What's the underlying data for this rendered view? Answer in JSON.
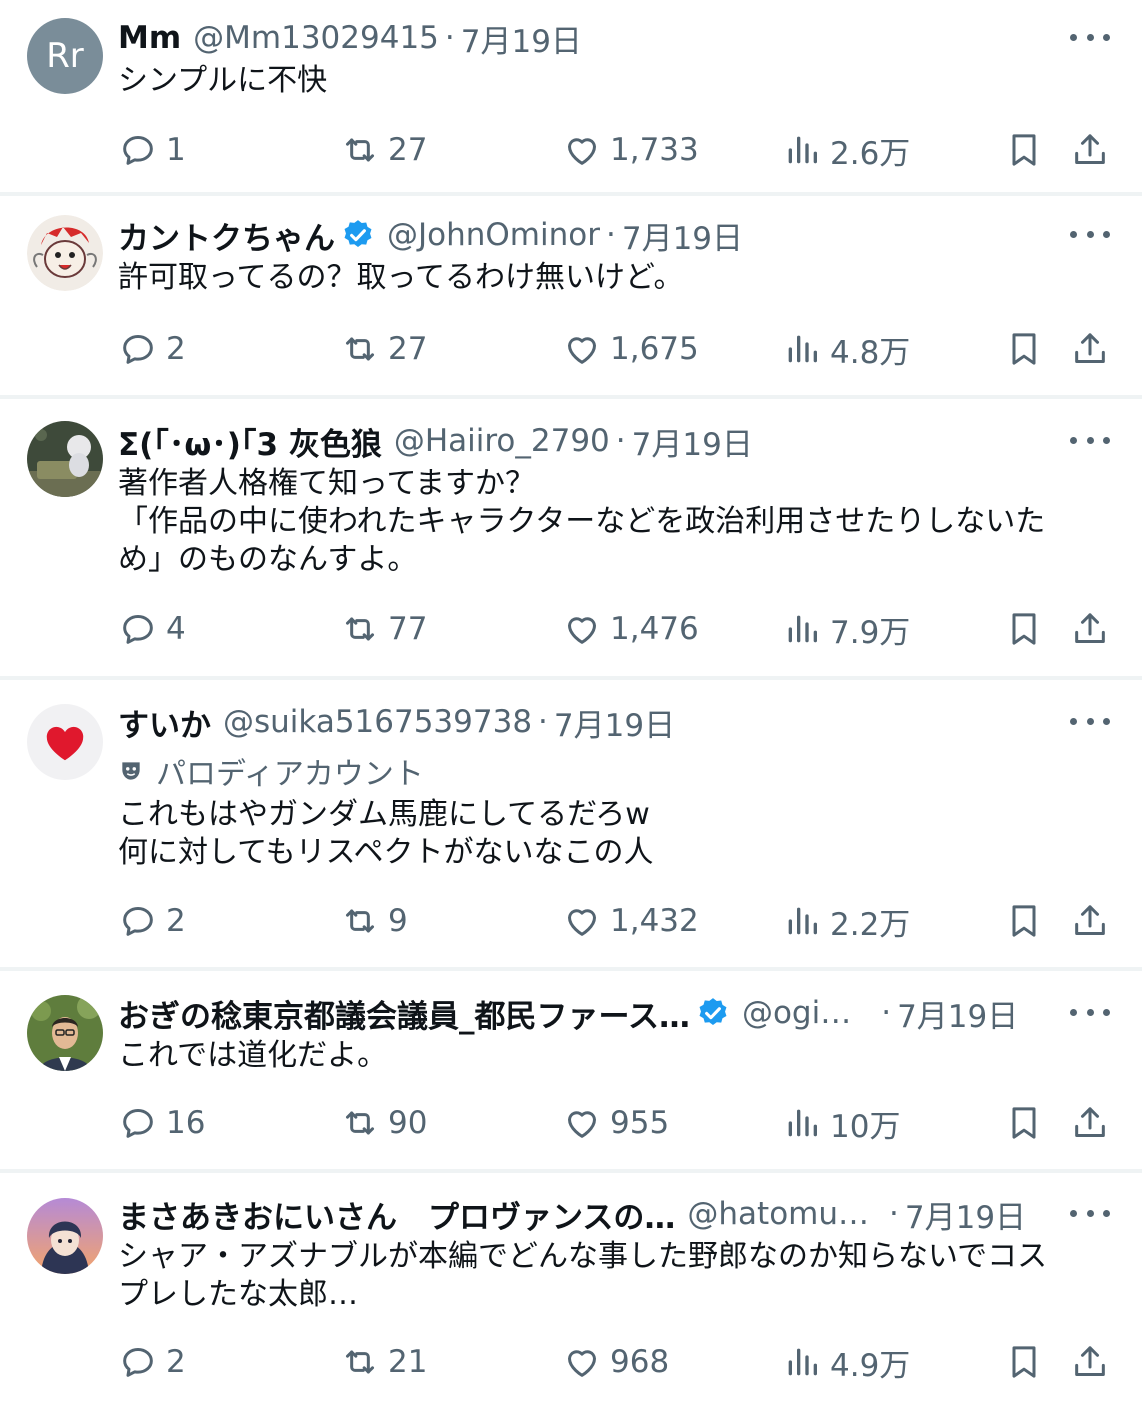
{
  "tweets": [
    {
      "name": "Mm",
      "handle": "@Mm13029415",
      "date": "7月19日",
      "avatar_initials": "Rr",
      "verified": false,
      "text": "シンプルに不快",
      "replies": "1",
      "retweets": "27",
      "likes": "1,733",
      "views": "2.6万"
    },
    {
      "name": "カントクちゃん",
      "handle": "@JohnOminor",
      "date": "7月19日",
      "verified": true,
      "text": "許可取ってるの？取ってるわけ無いけど。",
      "replies": "2",
      "retweets": "27",
      "likes": "1,675",
      "views": "4.8万"
    },
    {
      "name": "Σ(｢･ω･)｢3 灰色狼",
      "handle": "@Haiiro_2790",
      "date": "7月19日",
      "verified": false,
      "text": "著作者人格権て知ってますか？\n「作品の中に使われたキャラクターなどを政治利用させたりしないた\nめ」のものなんすよ。",
      "replies": "4",
      "retweets": "77",
      "likes": "1,476",
      "views": "7.9万"
    },
    {
      "name": "すいか",
      "handle": "@suika5167539738",
      "date": "7月19日",
      "verified": false,
      "parody_label": "パロディアカウント",
      "text": "これもはやガンダム馬鹿にしてるだろw\n何に対してもリスペクトがないなこの人",
      "replies": "2",
      "retweets": "9",
      "likes": "1,432",
      "views": "2.2万"
    },
    {
      "name": "おぎの稔東京都議会議員_都民ファース…",
      "handle": "@ogi…",
      "date": "7月19日",
      "verified": true,
      "text": "これでは道化だよ。",
      "replies": "16",
      "retweets": "90",
      "likes": "955",
      "views": "10万"
    },
    {
      "name": "まさあきおにいさん　プロヴァンスの…",
      "handle": "@hatomu…",
      "date": "7月19日",
      "verified": false,
      "text": "シャア・アズナブルが本編でどんな事した野郎なのか知らないでコス\nプレしたな太郎…",
      "replies": "2",
      "retweets": "21",
      "likes": "968",
      "views": "4.9万"
    }
  ],
  "colors": {
    "secondary_text": "#536471",
    "primary_text": "#0f1419",
    "verified_blue": "#1d9bf0",
    "divider": "#eff3f4"
  },
  "icons": [
    "reply-icon",
    "retweet-icon",
    "like-icon",
    "views-icon",
    "bookmark-icon",
    "share-icon",
    "more-icon",
    "verified-badge-icon",
    "parody-mask-icon"
  ]
}
